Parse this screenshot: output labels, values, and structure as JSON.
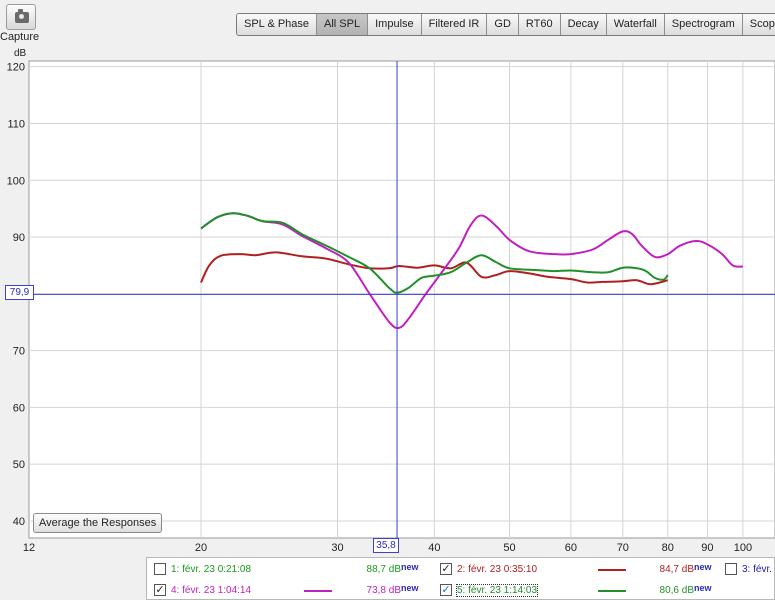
{
  "capture": {
    "label": "Capture",
    "icon": "camera-icon"
  },
  "axis": {
    "ylabel": "dB"
  },
  "tabs": [
    {
      "label": "SPL & Phase",
      "active": false
    },
    {
      "label": "All SPL",
      "active": true
    },
    {
      "label": "Impulse",
      "active": false
    },
    {
      "label": "Filtered IR",
      "active": false
    },
    {
      "label": "GD",
      "active": false
    },
    {
      "label": "RT60",
      "active": false
    },
    {
      "label": "Decay",
      "active": false
    },
    {
      "label": "Waterfall",
      "active": false
    },
    {
      "label": "Spectrogram",
      "active": false
    },
    {
      "label": "Scope",
      "active": false
    }
  ],
  "buttons": {
    "average": "Average the Responses"
  },
  "cursor": {
    "x_label": "35,8",
    "y_label": "79,9",
    "x": 35.8,
    "y": 79.9
  },
  "chart_data": {
    "type": "line",
    "xscale": "log",
    "ylabel": "dB",
    "xlim": [
      12,
      110
    ],
    "ylim": [
      37,
      121
    ],
    "xticks": [
      {
        "v": 12,
        "t": "12"
      },
      {
        "v": 20,
        "t": "20"
      },
      {
        "v": 30,
        "t": "30"
      },
      {
        "v": 40,
        "t": "40"
      },
      {
        "v": 50,
        "t": "50"
      },
      {
        "v": 60,
        "t": "60"
      },
      {
        "v": 70,
        "t": "70"
      },
      {
        "v": 80,
        "t": "80"
      },
      {
        "v": 90,
        "t": "90"
      },
      {
        "v": 100,
        "t": "100"
      }
    ],
    "yticks": [
      {
        "v": 40,
        "t": "40"
      },
      {
        "v": 50,
        "t": "50"
      },
      {
        "v": 60,
        "t": "60"
      },
      {
        "v": 70,
        "t": "70"
      },
      {
        "v": 80,
        "t": "80"
      },
      {
        "v": 90,
        "t": "90"
      },
      {
        "v": 100,
        "t": "100"
      },
      {
        "v": 110,
        "t": "110"
      },
      {
        "v": 120,
        "t": "120"
      }
    ],
    "series": [
      {
        "name": "2: févr. 23 0:35:10",
        "color": "#b02020",
        "points": [
          [
            20,
            82
          ],
          [
            20.5,
            85
          ],
          [
            21.2,
            86.7
          ],
          [
            22.5,
            87
          ],
          [
            23.5,
            86.8
          ],
          [
            25,
            87.3
          ],
          [
            27,
            86.6
          ],
          [
            29,
            86.2
          ],
          [
            31,
            85.2
          ],
          [
            33,
            84.5
          ],
          [
            35,
            84.5
          ],
          [
            36,
            84.9
          ],
          [
            38,
            84.6
          ],
          [
            40,
            85
          ],
          [
            42,
            84.5
          ],
          [
            44,
            85.5
          ],
          [
            46,
            83
          ],
          [
            48,
            83.3
          ],
          [
            50,
            84
          ],
          [
            53,
            83.6
          ],
          [
            56,
            83
          ],
          [
            60,
            82.6
          ],
          [
            63,
            82
          ],
          [
            66,
            82.1
          ],
          [
            70,
            82.2
          ],
          [
            73,
            82.4
          ],
          [
            76,
            81.7
          ],
          [
            80,
            82.4
          ]
        ]
      },
      {
        "name": "4: févr. 23 1:04:14",
        "color": "#c020c0",
        "points": [
          [
            20,
            91.5
          ],
          [
            21,
            93.5
          ],
          [
            22,
            94.2
          ],
          [
            23,
            93.7
          ],
          [
            24,
            92.8
          ],
          [
            25.5,
            92.2
          ],
          [
            27,
            90.2
          ],
          [
            29,
            88
          ],
          [
            31,
            85.5
          ],
          [
            33,
            80
          ],
          [
            35,
            75
          ],
          [
            36,
            74
          ],
          [
            37,
            75.5
          ],
          [
            39,
            80
          ],
          [
            41,
            84
          ],
          [
            43,
            88
          ],
          [
            44.5,
            92
          ],
          [
            46,
            93.8
          ],
          [
            48,
            92
          ],
          [
            50,
            89.5
          ],
          [
            53,
            87.5
          ],
          [
            57,
            87
          ],
          [
            60,
            87
          ],
          [
            64,
            87.8
          ],
          [
            67,
            89.5
          ],
          [
            70,
            91
          ],
          [
            72,
            90.5
          ],
          [
            74,
            88.5
          ],
          [
            77,
            86.5
          ],
          [
            80,
            87
          ],
          [
            83,
            88.5
          ],
          [
            87,
            89.3
          ],
          [
            90,
            88.7
          ],
          [
            94,
            87
          ],
          [
            97,
            85
          ],
          [
            100,
            84.8
          ]
        ]
      },
      {
        "name": "5: févr. 23 1:14:03",
        "color": "#20902a",
        "points": [
          [
            20,
            91.5
          ],
          [
            21,
            93.5
          ],
          [
            22,
            94.2
          ],
          [
            23,
            93.7
          ],
          [
            24,
            92.8
          ],
          [
            25.5,
            92.5
          ],
          [
            27,
            90.5
          ],
          [
            29,
            88.5
          ],
          [
            31,
            86.5
          ],
          [
            33,
            84.5
          ],
          [
            35,
            81
          ],
          [
            35.8,
            80.2
          ],
          [
            37,
            81
          ],
          [
            38.5,
            82.8
          ],
          [
            40,
            83.2
          ],
          [
            42,
            83.8
          ],
          [
            44,
            85.5
          ],
          [
            46,
            86.8
          ],
          [
            48,
            85.6
          ],
          [
            50,
            84.5
          ],
          [
            54,
            84.2
          ],
          [
            57,
            84
          ],
          [
            60,
            84.1
          ],
          [
            64,
            83.8
          ],
          [
            67,
            83.8
          ],
          [
            70,
            84.6
          ],
          [
            73,
            84.5
          ],
          [
            75,
            84
          ],
          [
            77,
            82.8
          ],
          [
            79,
            82.5
          ],
          [
            80,
            83.3
          ]
        ]
      }
    ]
  },
  "legend": [
    {
      "label": "1: févr. 23 0:21:08",
      "checked": false,
      "color": "#1a9a1a",
      "value": "88,7 dB",
      "badge": "new",
      "show_swatch": false
    },
    {
      "label": "2: févr. 23 0:35:10",
      "checked": true,
      "color": "#b02020",
      "value": "84,7 dB",
      "badge": "new",
      "show_swatch": true
    },
    {
      "label": "3: févr.",
      "checked": false,
      "color": "#1a1ab0",
      "value": "",
      "badge": "",
      "show_swatch": false
    },
    {
      "label": "4: févr. 23 1:04:14",
      "checked": true,
      "color": "#c020c0",
      "value": "73,8 dB",
      "badge": "new",
      "show_swatch": true
    },
    {
      "label": "5: févr. 23 1:14:03",
      "checked": true,
      "color": "#20902a",
      "value": "80,6 dB",
      "badge": "new",
      "show_swatch": true
    }
  ]
}
